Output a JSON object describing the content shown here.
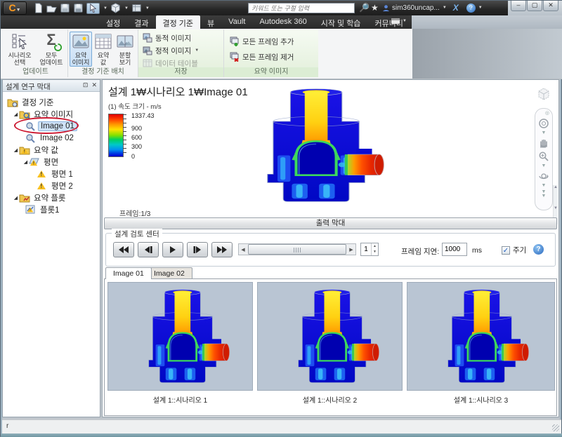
{
  "titlebar": {
    "app_letter": "C",
    "search_placeholder": "키워드 또는 구절 입력",
    "user_label": "sim360uncap...",
    "exchange_label": "X",
    "help_label": "?",
    "minimize": "‒",
    "maximize": "▢",
    "close": "✕"
  },
  "menu": {
    "tabs": [
      "설정",
      "결과",
      "결정 기준",
      "뷰",
      "Vault",
      "Autodesk 360",
      "시작 및 학습",
      "커뮤니티"
    ],
    "active_tab": "결정 기준"
  },
  "ribbon": {
    "groups": [
      {
        "label": "업데이트"
      },
      {
        "label": "결정 기준 배치"
      },
      {
        "label": "저장"
      },
      {
        "label": "요약 이미지"
      }
    ],
    "buttons": {
      "scenario_select": "시나리오\n선택",
      "update_all": "모두\n업데이트",
      "summary_image": "요약\n이미지",
      "summary_value": "요약\n값",
      "split_view": "분할\n보기",
      "dynamic_image": "동적 이미지",
      "static_image": "정적 이미지",
      "data_table": "데이터 테이블",
      "add_all_frames": "모든 프레임 추가",
      "remove_all_frames": "모든 프레임 제거"
    }
  },
  "sidebar": {
    "title": "설계 연구 막대",
    "tree": [
      {
        "label": "결정 기준"
      },
      {
        "label": "요약 이미지"
      },
      {
        "label": "Image 01"
      },
      {
        "label": "Image 02"
      },
      {
        "label": "요약 값"
      },
      {
        "label": "평면"
      },
      {
        "label": "평면 1"
      },
      {
        "label": "평면 2"
      },
      {
        "label": "요약 플롯"
      },
      {
        "label": "플롯1"
      }
    ],
    "selected_item": "Image 01"
  },
  "main": {
    "breadcrumb": "설계 1₩시나리오 1₩Image 01",
    "legend_title": "(1) 속도 크기 - m/s",
    "legend_ticks": [
      "1337.43",
      "900",
      "600",
      "300",
      "0"
    ],
    "frame_label": "프레임:1/3",
    "output_bar_label": "출력 막대"
  },
  "review": {
    "title": "설계 검토 센터",
    "frame_value": "1",
    "delay_label": "프레임 지연:",
    "delay_value": "1000",
    "delay_unit": "ms",
    "cycle_label": "주기",
    "help_label": "?"
  },
  "bottom": {
    "tabs": [
      "Image 01",
      "Image 02"
    ],
    "active_tab": "Image 01",
    "thumbnails": [
      {
        "caption": "설계 1::시나리오 1"
      },
      {
        "caption": "설계 1::시나리오 2"
      },
      {
        "caption": "설계 1::시나리오 3"
      }
    ]
  },
  "statusbar": {
    "text": "r"
  },
  "colors": {
    "legend_max": "#e00000",
    "legend_min": "#0000d0",
    "selection_blue": "#cfe3f8",
    "annotation_red": "#cc1830",
    "thumbnail_bg": "#b9c5d3"
  }
}
